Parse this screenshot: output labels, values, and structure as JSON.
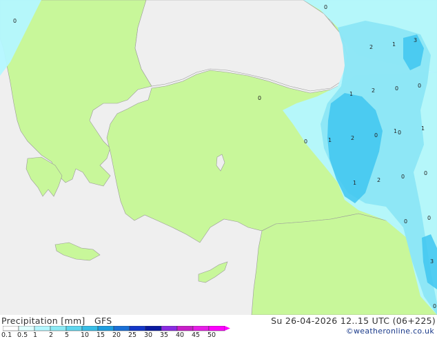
{
  "footer": {
    "title": "Precipitation [mm]",
    "model": "GFS",
    "datetime": "Su 26-04-2026 12..15 UTC (06+225)",
    "credit": "©weatheronline.co.uk"
  },
  "legend": {
    "ticks": [
      "0.1",
      "0.5",
      "1",
      "2",
      "5",
      "10",
      "15",
      "20",
      "25",
      "30",
      "35",
      "40",
      "45",
      "50"
    ],
    "colors": [
      "#ffffff",
      "#e0ffff",
      "#b4f7ff",
      "#8ceaf5",
      "#5fd6ee",
      "#38bde6",
      "#1e9ee0",
      "#1a6fd6",
      "#1437c8",
      "#0a1aa0",
      "#8a2be2",
      "#c81ec8",
      "#e61ee6",
      "#ff00ff"
    ]
  },
  "map": {
    "land_color": "#c8f79a",
    "sea_color": "#efefef",
    "precip_light": "#b4f7ff",
    "precip_mid": "#8ce6f5",
    "precip_heavy": "#3fc6f0",
    "labels": [
      {
        "text": "0"
      },
      {
        "text": "0"
      },
      {
        "text": "2"
      },
      {
        "text": "1"
      },
      {
        "text": "3"
      },
      {
        "text": "1"
      },
      {
        "text": "2"
      },
      {
        "text": "0"
      },
      {
        "text": "0"
      },
      {
        "text": "0"
      },
      {
        "text": "1"
      },
      {
        "text": "0"
      },
      {
        "text": "1"
      },
      {
        "text": "2"
      },
      {
        "text": "0"
      },
      {
        "text": "0"
      },
      {
        "text": "1"
      },
      {
        "text": "1"
      },
      {
        "text": "2"
      },
      {
        "text": "0"
      },
      {
        "text": "0"
      },
      {
        "text": "0"
      },
      {
        "text": "0"
      },
      {
        "text": "3"
      },
      {
        "text": "0"
      }
    ]
  }
}
